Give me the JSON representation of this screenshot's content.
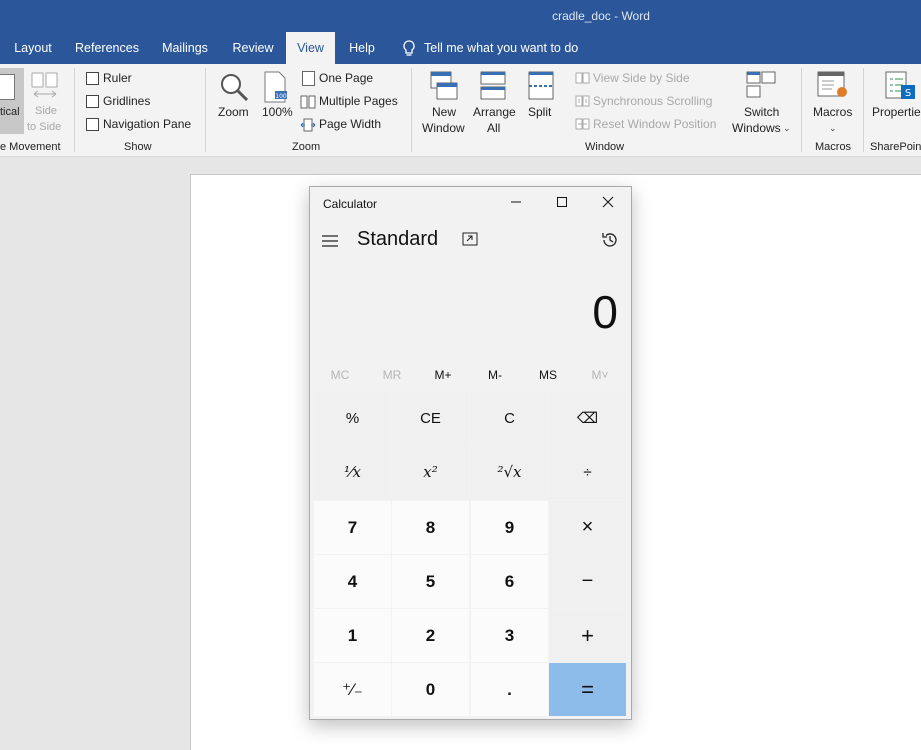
{
  "window": {
    "title": "cradle_doc  -  Word"
  },
  "tabs": [
    {
      "label": "Layout"
    },
    {
      "label": "References"
    },
    {
      "label": "Mailings"
    },
    {
      "label": "Review"
    },
    {
      "label": "View"
    },
    {
      "label": "Help"
    },
    {
      "label": "Tell me what you want to do"
    }
  ],
  "ribbon": {
    "page_movement": {
      "vertical": "tical",
      "side_to_side": [
        "Side",
        "to Side"
      ],
      "group": "e Movement"
    },
    "show": {
      "ruler": "Ruler",
      "gridlines": "Gridlines",
      "navigation_pane": "Navigation Pane",
      "group": "Show"
    },
    "zoom": {
      "zoom": "Zoom",
      "hundred": "100%",
      "one_page": "One Page",
      "multiple_pages": "Multiple Pages",
      "page_width": "Page Width",
      "group": "Zoom"
    },
    "window": {
      "new_window": [
        "New",
        "Window"
      ],
      "arrange_all": [
        "Arrange",
        "All"
      ],
      "split": "Split",
      "view_side_by_side": "View Side by Side",
      "synchronous_scrolling": "Synchronous Scrolling",
      "reset_window_position": "Reset Window Position",
      "switch_windows": [
        "Switch",
        "Windows"
      ],
      "group": "Window"
    },
    "macros": {
      "label": "Macros",
      "group": "Macros"
    },
    "sharepoint": {
      "label": "Properties",
      "group": "SharePoint"
    }
  },
  "calculator": {
    "title": "Calculator",
    "mode": "Standard",
    "display": "0",
    "memory": [
      "MC",
      "MR",
      "M+",
      "M-",
      "MS",
      "M˅"
    ],
    "keys": [
      [
        "%",
        "CE",
        "C",
        "⌫"
      ],
      [
        "¹⁄x",
        "x²",
        "²√x",
        "÷"
      ],
      [
        "7",
        "8",
        "9",
        "×"
      ],
      [
        "4",
        "5",
        "6",
        "−"
      ],
      [
        "1",
        "2",
        "3",
        "+"
      ],
      [
        "⁺⁄₋",
        "0",
        ".",
        "="
      ]
    ]
  }
}
